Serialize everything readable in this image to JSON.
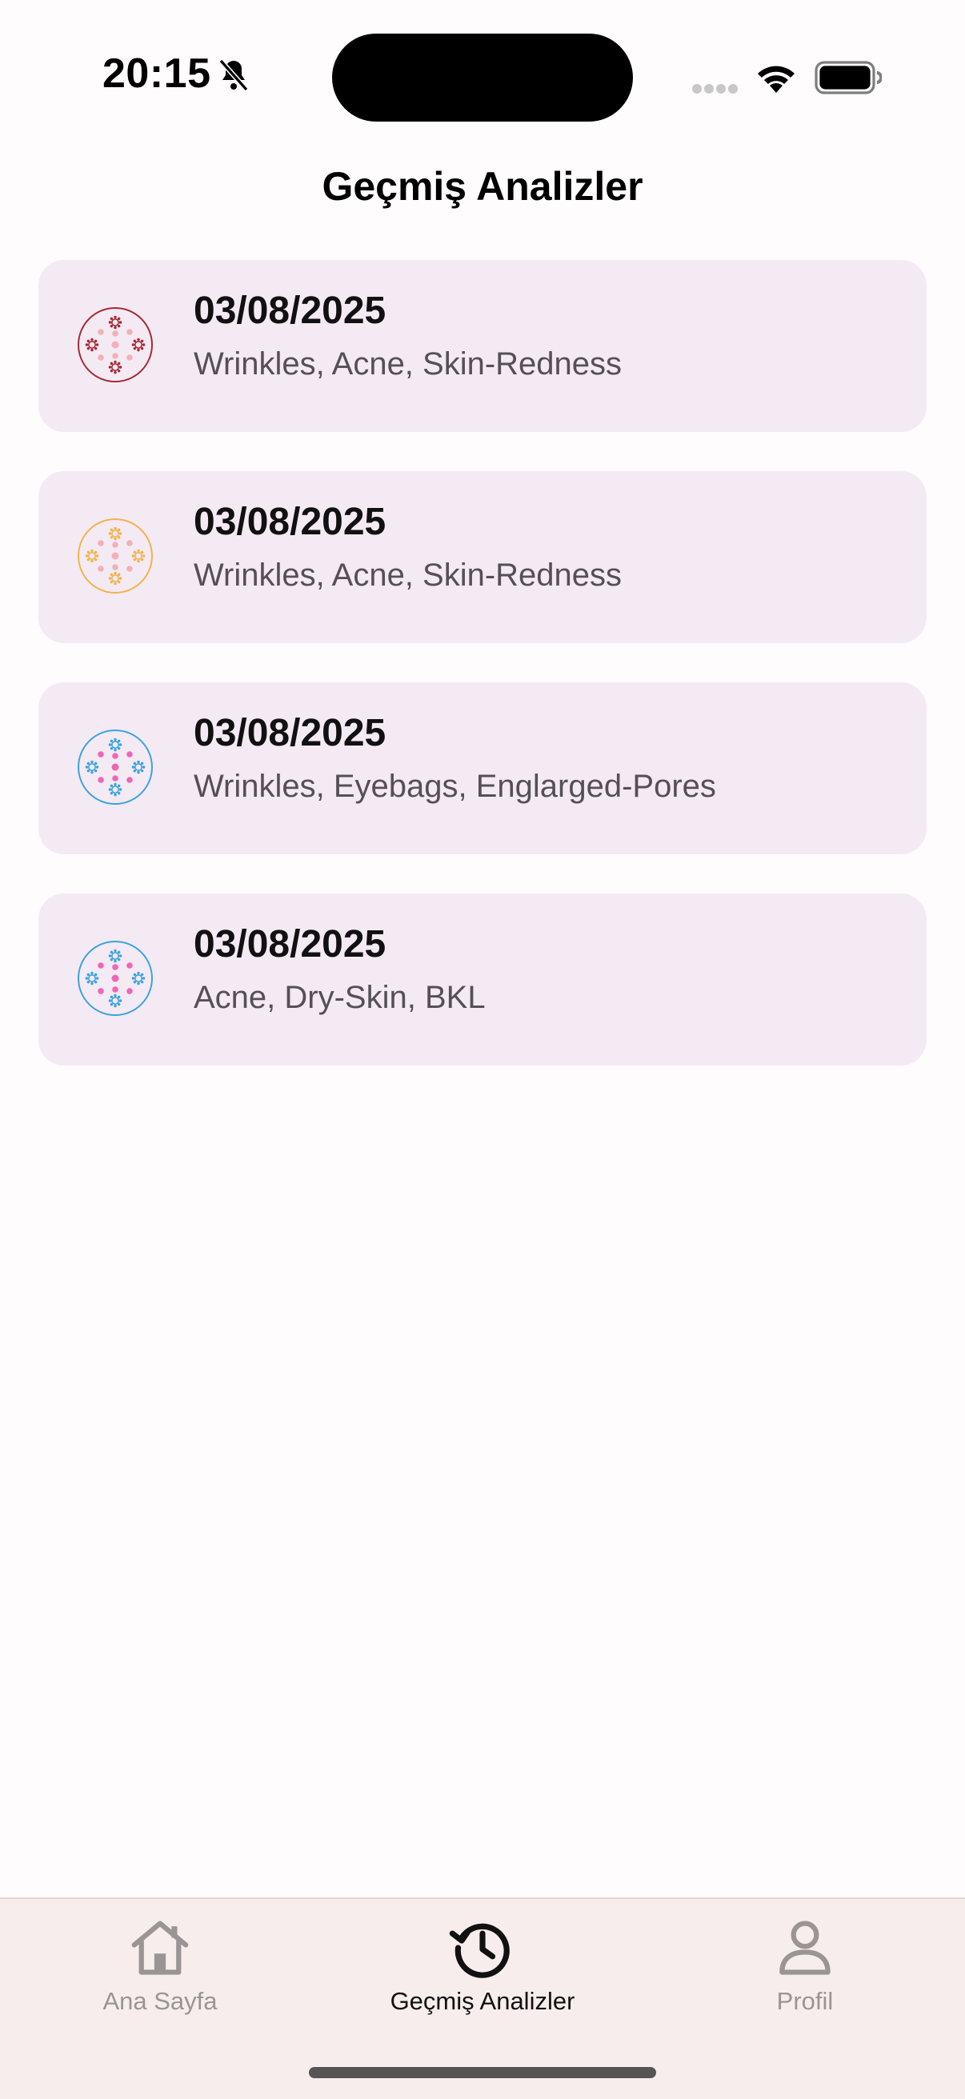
{
  "status_bar": {
    "time": "20:15",
    "icons": [
      "bell-slash-icon",
      "signal-icon",
      "wifi-icon",
      "battery-icon"
    ]
  },
  "header": {
    "title": "Geçmiş Analizler"
  },
  "analyses": [
    {
      "date": "03/08/2025",
      "tags": "Wrinkles, Acne, Skin-Redness",
      "icon": "analysis-dots-icon",
      "accent": "#a52a35",
      "dot": "#f3b0b8"
    },
    {
      "date": "03/08/2025",
      "tags": "Wrinkles, Acne, Skin-Redness",
      "icon": "analysis-dots-icon",
      "accent": "#f4b24a",
      "dot": "#f3b0b8"
    },
    {
      "date": "03/08/2025",
      "tags": "Wrinkles, Eyebags, Englarged-Pores",
      "icon": "analysis-dots-icon",
      "accent": "#3aa3e0",
      "dot": "#f066b4"
    },
    {
      "date": "03/08/2025",
      "tags": "Acne, Dry-Skin, BKL",
      "icon": "analysis-dots-icon",
      "accent": "#3aa3e0",
      "dot": "#f066b4"
    }
  ],
  "bottom_nav": {
    "items": [
      {
        "label": "Ana Sayfa",
        "icon": "home-icon",
        "active": false
      },
      {
        "label": "Geçmiş Analizler",
        "icon": "history-icon",
        "active": true
      },
      {
        "label": "Profil",
        "icon": "user-icon",
        "active": false
      }
    ]
  }
}
